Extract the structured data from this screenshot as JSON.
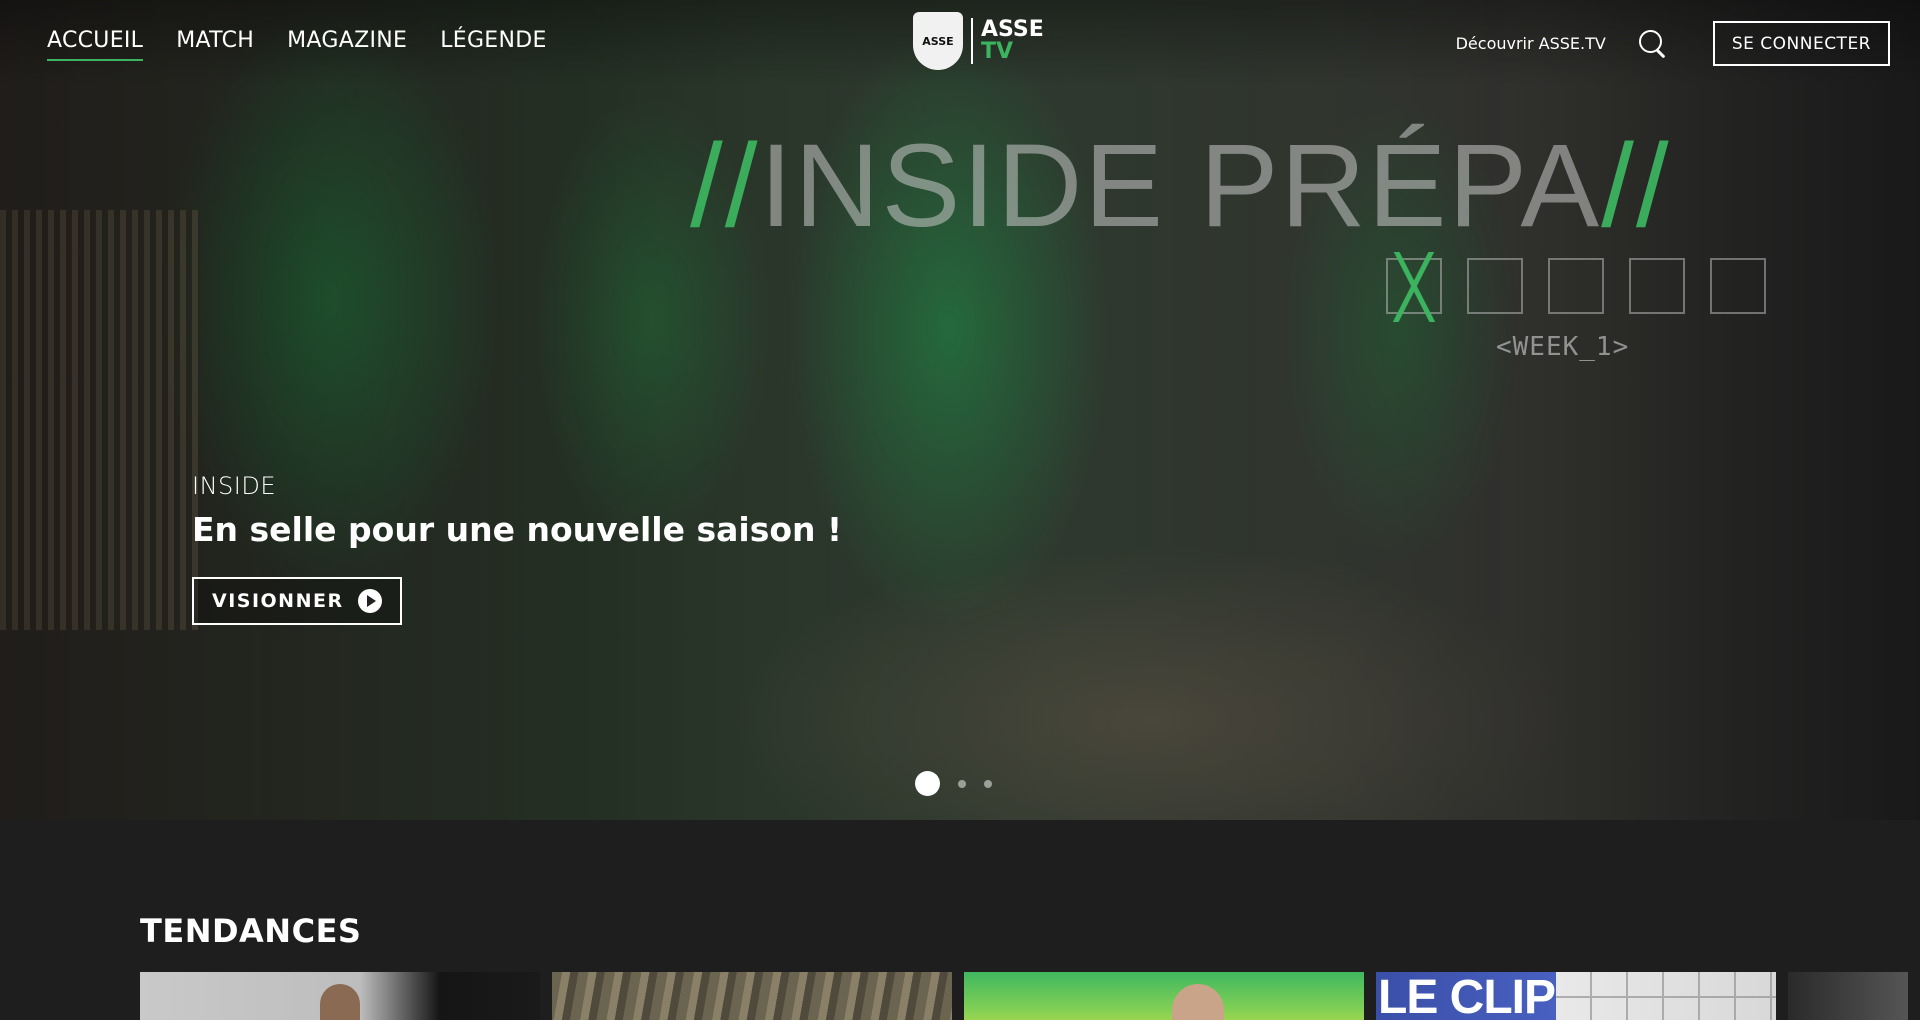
{
  "header": {
    "nav": [
      {
        "label": "ACCUEIL",
        "active": true
      },
      {
        "label": "MATCH",
        "active": false
      },
      {
        "label": "MAGAZINE",
        "active": false
      },
      {
        "label": "LÉGENDE",
        "active": false
      }
    ],
    "logo": {
      "name": "ASSE",
      "sub": "TV",
      "badge": "ASSE"
    },
    "discover_label": "Découvrir ASSE.TV",
    "search_icon": "search-icon",
    "login_label": "SE CONNECTER"
  },
  "hero": {
    "promo_title_left": "//",
    "promo_title_main": "INSIDE PRÉPA",
    "promo_title_right": "//",
    "week_label": "<WEEK_1>",
    "kicker": "INSIDE",
    "title": "En selle pour une nouvelle saison !",
    "watch_label": "VISIONNER",
    "slides_total": 3,
    "slide_active": 1
  },
  "trends": {
    "title": "TENDANCES",
    "card4_text": "LE CLIP"
  },
  "colors": {
    "accent": "#3cb35f",
    "background": "#1e1e1e"
  }
}
